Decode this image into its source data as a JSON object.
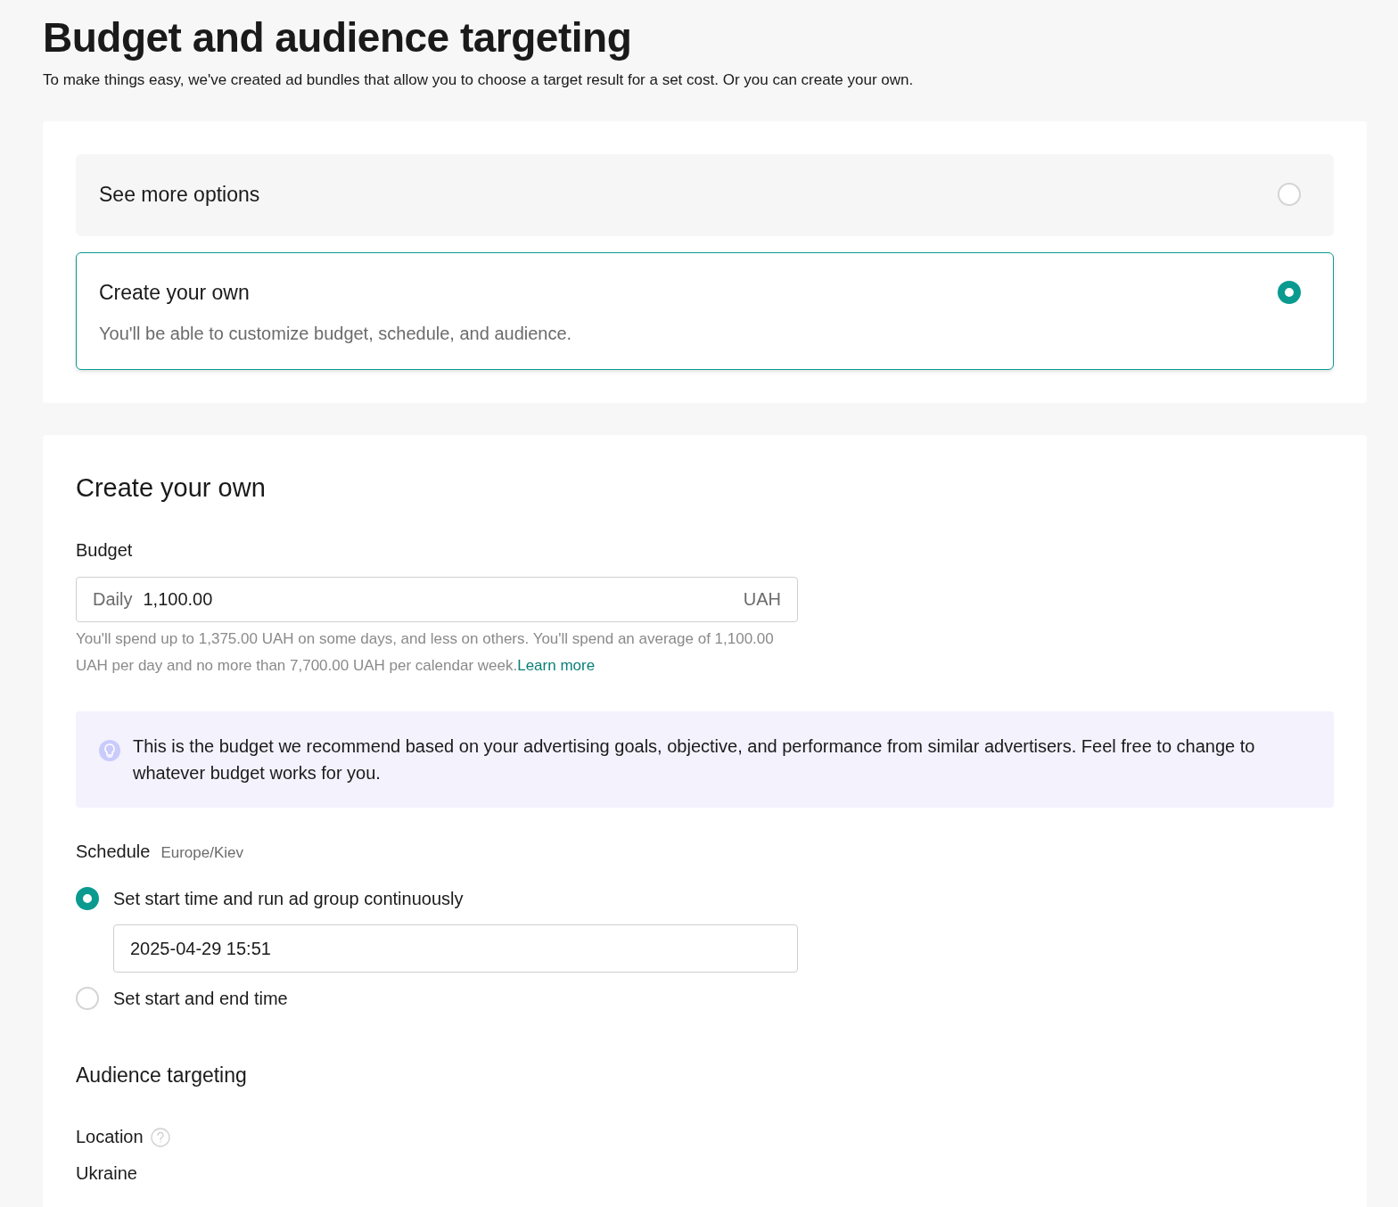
{
  "title": "Budget and audience targeting",
  "subtitle": "To make things easy, we've created ad bundles that allow you to choose a target result for a set cost. Or you can create your own.",
  "bundle_options": [
    {
      "title": "See more options",
      "selected": false
    },
    {
      "title": "Create your own",
      "description": "You'll be able to customize budget, schedule, and audience.",
      "selected": true
    }
  ],
  "custom": {
    "heading": "Create your own",
    "budget": {
      "label": "Budget",
      "period": "Daily",
      "value": "1,100.00",
      "currency": "UAH",
      "hint": "You'll spend up to 1,375.00 UAH on some days, and less on others. You'll spend an average of 1,100.00 UAH per day and no more than 7,700.00 UAH per calendar week.",
      "hint_link": "Learn more"
    },
    "recommendation": "This is the budget we recommend based on your advertising goals, objective, and performance from similar advertisers. Feel free to change to whatever budget works for you.",
    "schedule": {
      "label": "Schedule",
      "timezone": "Europe/Kiev",
      "options": [
        {
          "label": "Set start time and run ad group continuously",
          "selected": true,
          "start_value": "2025-04-29 15:51"
        },
        {
          "label": "Set start and end time",
          "selected": false
        }
      ]
    },
    "audience": {
      "heading": "Audience targeting",
      "location": {
        "label": "Location",
        "value": "Ukraine"
      }
    }
  }
}
